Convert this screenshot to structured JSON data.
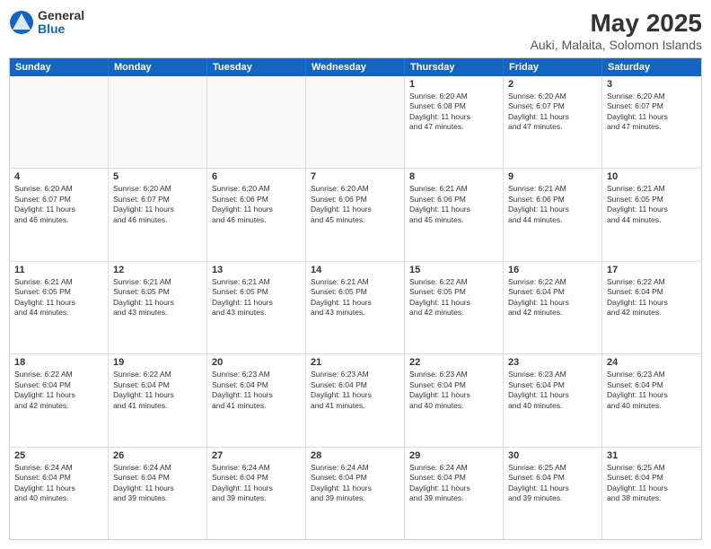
{
  "header": {
    "logo_general": "General",
    "logo_blue": "Blue",
    "main_title": "May 2025",
    "subtitle": "Auki, Malaita, Solomon Islands"
  },
  "calendar": {
    "days_of_week": [
      "Sunday",
      "Monday",
      "Tuesday",
      "Wednesday",
      "Thursday",
      "Friday",
      "Saturday"
    ],
    "weeks": [
      [
        {
          "day": "",
          "info": ""
        },
        {
          "day": "",
          "info": ""
        },
        {
          "day": "",
          "info": ""
        },
        {
          "day": "",
          "info": ""
        },
        {
          "day": "1",
          "info": "Sunrise: 6:20 AM\nSunset: 6:08 PM\nDaylight: 11 hours\nand 47 minutes."
        },
        {
          "day": "2",
          "info": "Sunrise: 6:20 AM\nSunset: 6:07 PM\nDaylight: 11 hours\nand 47 minutes."
        },
        {
          "day": "3",
          "info": "Sunrise: 6:20 AM\nSunset: 6:07 PM\nDaylight: 11 hours\nand 47 minutes."
        }
      ],
      [
        {
          "day": "4",
          "info": "Sunrise: 6:20 AM\nSunset: 6:07 PM\nDaylight: 11 hours\nand 46 minutes."
        },
        {
          "day": "5",
          "info": "Sunrise: 6:20 AM\nSunset: 6:07 PM\nDaylight: 11 hours\nand 46 minutes."
        },
        {
          "day": "6",
          "info": "Sunrise: 6:20 AM\nSunset: 6:06 PM\nDaylight: 11 hours\nand 46 minutes."
        },
        {
          "day": "7",
          "info": "Sunrise: 6:20 AM\nSunset: 6:06 PM\nDaylight: 11 hours\nand 45 minutes."
        },
        {
          "day": "8",
          "info": "Sunrise: 6:21 AM\nSunset: 6:06 PM\nDaylight: 11 hours\nand 45 minutes."
        },
        {
          "day": "9",
          "info": "Sunrise: 6:21 AM\nSunset: 6:06 PM\nDaylight: 11 hours\nand 44 minutes."
        },
        {
          "day": "10",
          "info": "Sunrise: 6:21 AM\nSunset: 6:05 PM\nDaylight: 11 hours\nand 44 minutes."
        }
      ],
      [
        {
          "day": "11",
          "info": "Sunrise: 6:21 AM\nSunset: 6:05 PM\nDaylight: 11 hours\nand 44 minutes."
        },
        {
          "day": "12",
          "info": "Sunrise: 6:21 AM\nSunset: 6:05 PM\nDaylight: 11 hours\nand 43 minutes."
        },
        {
          "day": "13",
          "info": "Sunrise: 6:21 AM\nSunset: 6:05 PM\nDaylight: 11 hours\nand 43 minutes."
        },
        {
          "day": "14",
          "info": "Sunrise: 6:21 AM\nSunset: 6:05 PM\nDaylight: 11 hours\nand 43 minutes."
        },
        {
          "day": "15",
          "info": "Sunrise: 6:22 AM\nSunset: 6:05 PM\nDaylight: 11 hours\nand 42 minutes."
        },
        {
          "day": "16",
          "info": "Sunrise: 6:22 AM\nSunset: 6:04 PM\nDaylight: 11 hours\nand 42 minutes."
        },
        {
          "day": "17",
          "info": "Sunrise: 6:22 AM\nSunset: 6:04 PM\nDaylight: 11 hours\nand 42 minutes."
        }
      ],
      [
        {
          "day": "18",
          "info": "Sunrise: 6:22 AM\nSunset: 6:04 PM\nDaylight: 11 hours\nand 42 minutes."
        },
        {
          "day": "19",
          "info": "Sunrise: 6:22 AM\nSunset: 6:04 PM\nDaylight: 11 hours\nand 41 minutes."
        },
        {
          "day": "20",
          "info": "Sunrise: 6:23 AM\nSunset: 6:04 PM\nDaylight: 11 hours\nand 41 minutes."
        },
        {
          "day": "21",
          "info": "Sunrise: 6:23 AM\nSunset: 6:04 PM\nDaylight: 11 hours\nand 41 minutes."
        },
        {
          "day": "22",
          "info": "Sunrise: 6:23 AM\nSunset: 6:04 PM\nDaylight: 11 hours\nand 40 minutes."
        },
        {
          "day": "23",
          "info": "Sunrise: 6:23 AM\nSunset: 6:04 PM\nDaylight: 11 hours\nand 40 minutes."
        },
        {
          "day": "24",
          "info": "Sunrise: 6:23 AM\nSunset: 6:04 PM\nDaylight: 11 hours\nand 40 minutes."
        }
      ],
      [
        {
          "day": "25",
          "info": "Sunrise: 6:24 AM\nSunset: 6:04 PM\nDaylight: 11 hours\nand 40 minutes."
        },
        {
          "day": "26",
          "info": "Sunrise: 6:24 AM\nSunset: 6:04 PM\nDaylight: 11 hours\nand 39 minutes."
        },
        {
          "day": "27",
          "info": "Sunrise: 6:24 AM\nSunset: 6:04 PM\nDaylight: 11 hours\nand 39 minutes."
        },
        {
          "day": "28",
          "info": "Sunrise: 6:24 AM\nSunset: 6:04 PM\nDaylight: 11 hours\nand 39 minutes."
        },
        {
          "day": "29",
          "info": "Sunrise: 6:24 AM\nSunset: 6:04 PM\nDaylight: 11 hours\nand 39 minutes."
        },
        {
          "day": "30",
          "info": "Sunrise: 6:25 AM\nSunset: 6:04 PM\nDaylight: 11 hours\nand 39 minutes."
        },
        {
          "day": "31",
          "info": "Sunrise: 6:25 AM\nSunset: 6:04 PM\nDaylight: 11 hours\nand 38 minutes."
        }
      ]
    ]
  }
}
